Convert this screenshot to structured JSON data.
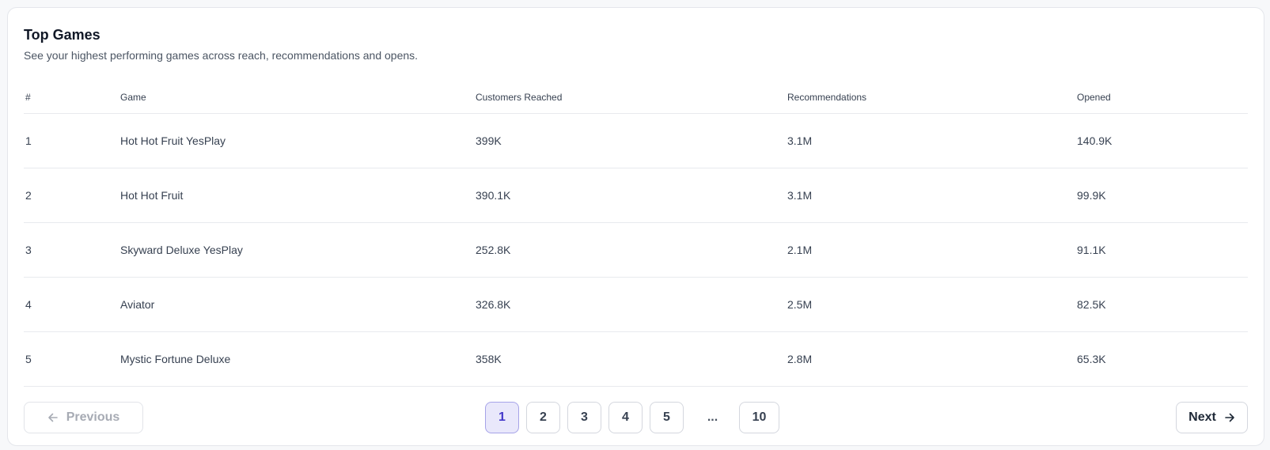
{
  "card": {
    "title": "Top Games",
    "subtitle": "See your highest performing games across reach, recommendations and opens."
  },
  "table": {
    "columns": [
      "#",
      "Game",
      "Customers Reached",
      "Recommendations",
      "Opened"
    ],
    "rows": [
      [
        "1",
        "Hot Hot Fruit YesPlay",
        "399K",
        "3.1M",
        "140.9K"
      ],
      [
        "2",
        "Hot Hot Fruit",
        "390.1K",
        "3.1M",
        "99.9K"
      ],
      [
        "3",
        "Skyward Deluxe YesPlay",
        "252.8K",
        "2.1M",
        "91.1K"
      ],
      [
        "4",
        "Aviator",
        "326.8K",
        "2.5M",
        "82.5K"
      ],
      [
        "5",
        "Mystic Fortune Deluxe",
        "358K",
        "2.8M",
        "65.3K"
      ]
    ]
  },
  "pagination": {
    "previous_label": "Previous",
    "next_label": "Next",
    "pages": [
      "1",
      "2",
      "3",
      "4",
      "5"
    ],
    "ellipsis": "...",
    "last_page": "10",
    "current_page": "1",
    "icons": {
      "previous": "arrow-left-icon",
      "next": "arrow-right-icon"
    },
    "colors": {
      "active_bg": "#e9e8fb",
      "active_border": "#a6a3e8",
      "active_text": "#4338ca"
    }
  }
}
